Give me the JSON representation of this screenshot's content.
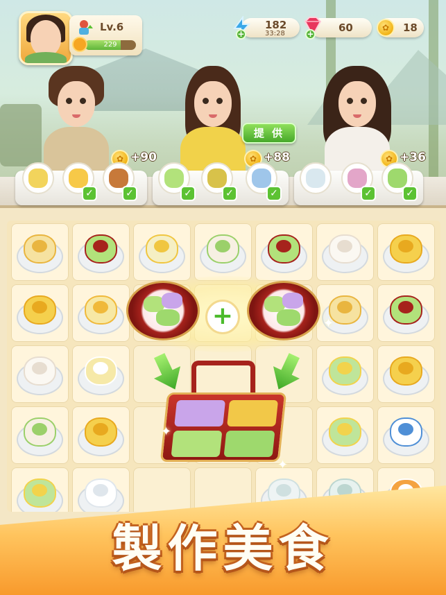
{
  "hud": {
    "level": "Lv.6",
    "xp": "229",
    "xp_fraction": 0.7,
    "energy": "182",
    "energy_timer": "33:28",
    "gems": "60",
    "coins": "18"
  },
  "customers": [
    {
      "reward": "+90",
      "hair": "#5a3520",
      "shirt": "#d9c49a"
    },
    {
      "reward": "+88",
      "hair": "#4a2a1a",
      "shirt": "#f1d24a"
    },
    {
      "reward": "+36",
      "hair": "#3b2418",
      "shirt": "#f4f0ea"
    }
  ],
  "provide_button": "提 供",
  "banner_title": "製作美食",
  "colors": {
    "accent_green": "#5cc233",
    "banner_orange": "#f89a2c",
    "board_bg": "#f6e6bd"
  },
  "board": {
    "items": [
      [
        "bun",
        "box",
        "cake",
        "roll",
        "box",
        "steamed-bun",
        "flower-cake"
      ],
      [
        "flower-cake",
        "tofu",
        "",
        "",
        "",
        "bun",
        "box"
      ],
      [
        "steamed-bun",
        "soup",
        "",
        "",
        "",
        "sandwich",
        "flower-cake"
      ],
      [
        "roll",
        "flower-cake",
        "",
        "",
        "",
        "sandwich",
        "teapot"
      ],
      [
        "sandwich",
        "napkin",
        "",
        "",
        "cup",
        "vase",
        "tea"
      ]
    ]
  }
}
